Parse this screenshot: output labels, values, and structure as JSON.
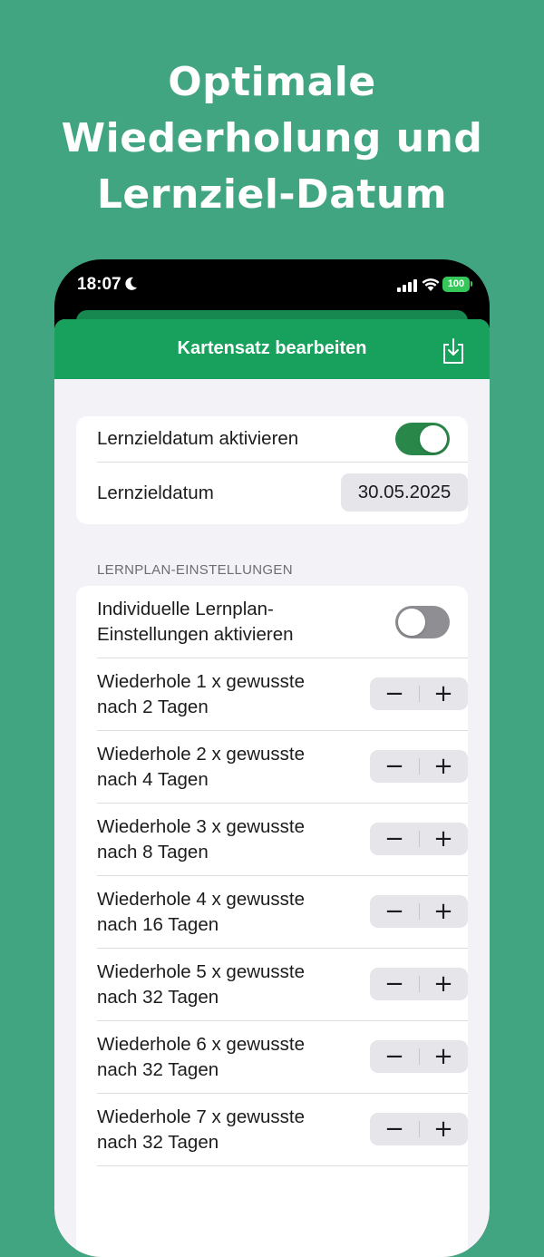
{
  "headline": [
    "Optimale",
    "Wiederholung und",
    "Lernziel-Datum"
  ],
  "status_bar": {
    "time": "18:07",
    "battery": "100"
  },
  "nav": {
    "title": "Kartensatz bearbeiten",
    "save_icon": "save-download-icon"
  },
  "goal_group": {
    "enable_label": "Lernzieldatum aktivieren",
    "enable_on": true,
    "date_label": "Lernzieldatum",
    "date_value": "30.05.2025"
  },
  "plan_group": {
    "section_title": "LERNPLAN-EINSTELLUNGEN",
    "individual_label_line1": "Individuelle Lernplan-",
    "individual_label_line2": "Einstellungen aktivieren",
    "individual_on": false,
    "stepper_minus": "−",
    "stepper_plus": "+",
    "rows": [
      {
        "line1": "Wiederhole 1 x gewusste",
        "line2": "nach 2 Tagen"
      },
      {
        "line1": "Wiederhole 2 x gewusste",
        "line2": "nach 4 Tagen"
      },
      {
        "line1": "Wiederhole 3 x gewusste",
        "line2": "nach 8 Tagen"
      },
      {
        "line1": "Wiederhole 4 x gewusste",
        "line2": "nach 16 Tagen"
      },
      {
        "line1": "Wiederhole 5 x gewusste",
        "line2": "nach 32 Tagen"
      },
      {
        "line1": "Wiederhole 6 x gewusste",
        "line2": "nach 32 Tagen"
      },
      {
        "line1": "Wiederhole 7 x gewusste",
        "line2": "nach 32 Tagen"
      }
    ]
  },
  "colors": {
    "background": "#42a582",
    "navbar": "#18a15c",
    "toggle_on": "#29874a",
    "toggle_off": "#8e8e93"
  }
}
